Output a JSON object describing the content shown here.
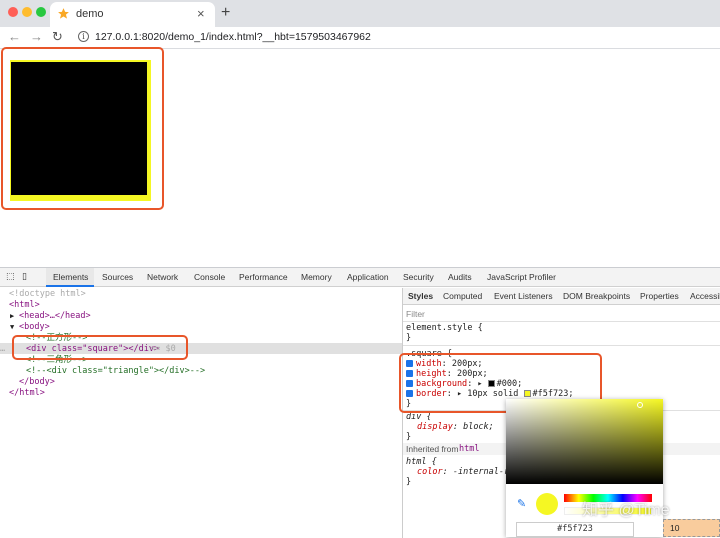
{
  "browser": {
    "tab_title": "demo",
    "url": "127.0.0.1:8020/demo_1/index.html?__hbt=1579503467962",
    "info_glyph": "i",
    "colors": {
      "close": "#ff5f57",
      "minimize": "#febc2e",
      "zoom": "#28c840"
    }
  },
  "page": {
    "square": {
      "background": "#000",
      "border_color": "#f5f723"
    }
  },
  "devtools": {
    "tabs": [
      "Elements",
      "Sources",
      "Network",
      "Console",
      "Performance",
      "Memory",
      "Application",
      "Security",
      "Audits",
      "JavaScript Profiler"
    ],
    "selected_tab": "Elements",
    "dom": {
      "doctype": "<!doctype html>",
      "html_open": "<html>",
      "head": "<head>…</head>",
      "body_open": "<body>",
      "comment_square": "<!--正方形-->",
      "selected_div_tag": "<div class=\"square\"></div>",
      "selected_suffix": " == $0",
      "comment_triangle": "<!--三角形-->",
      "triangle_div": "<!--<div class=\"triangle\"></div>-->",
      "body_close": "</body>",
      "html_close": "</html>"
    },
    "styles_tabs": [
      "Styles",
      "Computed",
      "Event Listeners",
      "DOM Breakpoints",
      "Properties",
      "Accessibility"
    ],
    "filter_placeholder": "Filter",
    "element_style": "element.style {",
    "close_brace": "}",
    "square_rule": {
      "selector": ".square {",
      "width": {
        "prop": "width",
        "value": "200px;"
      },
      "height": {
        "prop": "height",
        "value": "200px;"
      },
      "background": {
        "prop": "background",
        "value": "#000;"
      },
      "border": {
        "prop": "border",
        "value": "10px solid ",
        "color": "#f5f723;"
      }
    },
    "div_rule": {
      "selector": "div {",
      "prop": "display",
      "value": "block;"
    },
    "inherited_from": "Inherited from",
    "inherited_tag": "html",
    "html_rule": {
      "selector": "html {",
      "prop": "color",
      "value": "-internal-ro"
    },
    "color_picker": {
      "hex": "#f5f723"
    },
    "box_model_value": "10"
  },
  "watermark": "知乎 @Time"
}
